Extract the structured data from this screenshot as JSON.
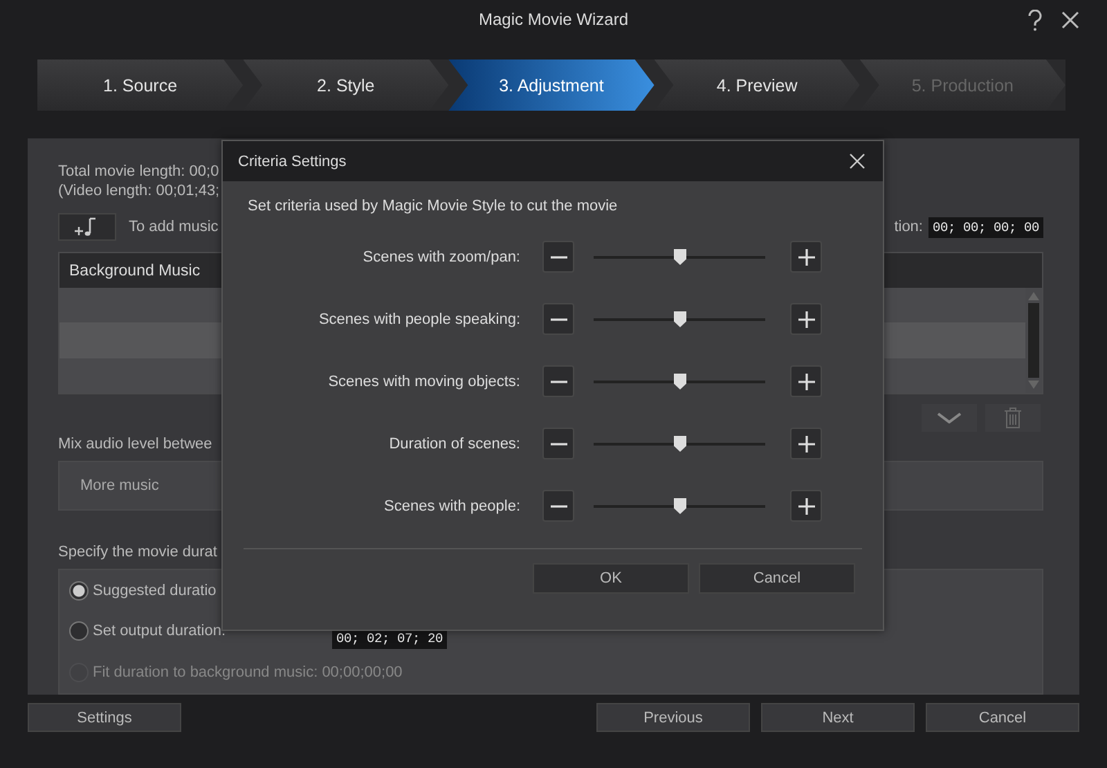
{
  "window": {
    "title": "Magic Movie Wizard"
  },
  "steps": [
    {
      "label": "1. Source",
      "selected": false,
      "disabled": false
    },
    {
      "label": "2. Style",
      "selected": false,
      "disabled": false
    },
    {
      "label": "3. Adjustment",
      "selected": true,
      "disabled": false
    },
    {
      "label": "4. Preview",
      "selected": false,
      "disabled": false
    },
    {
      "label": "5. Production",
      "selected": false,
      "disabled": true
    }
  ],
  "movie_info": {
    "length_text": "Total movie length: 00;0",
    "video_length_text": "(Video length: 00;01;43;"
  },
  "music": {
    "add_hint": "To add music",
    "duration_label": "tion:",
    "duration_value": "00; 00; 00; 00",
    "list_header": "Background Music"
  },
  "mix": {
    "label": "Mix audio level betwee",
    "left_label": "More music"
  },
  "duration": {
    "label": "Specify the movie durat",
    "options": [
      {
        "label": "Suggested duratio",
        "selected": true,
        "disabled": false
      },
      {
        "label": "Set output duration:",
        "selected": false,
        "disabled": false,
        "value": "00; 02; 07; 20"
      },
      {
        "label": "Fit duration to background music: 00;00;00;00",
        "selected": false,
        "disabled": true
      }
    ]
  },
  "footer": {
    "settings_button": "Settings",
    "nav_buttons": [
      "Previous",
      "Next",
      "Cancel"
    ]
  },
  "dialog": {
    "title": "Criteria Settings",
    "intro": "Set criteria used by Magic Movie Style to cut the movie",
    "criteria": [
      {
        "label": "Scenes with zoom/pan:",
        "level": 0.5
      },
      {
        "label": "Scenes with people speaking:",
        "level": 0.5
      },
      {
        "label": "Scenes with moving objects:",
        "level": 0.5
      },
      {
        "label": "Duration of scenes:",
        "level": 0.5
      },
      {
        "label": "Scenes with people:",
        "level": 0.5
      }
    ],
    "buttons": [
      "OK",
      "Cancel"
    ]
  }
}
